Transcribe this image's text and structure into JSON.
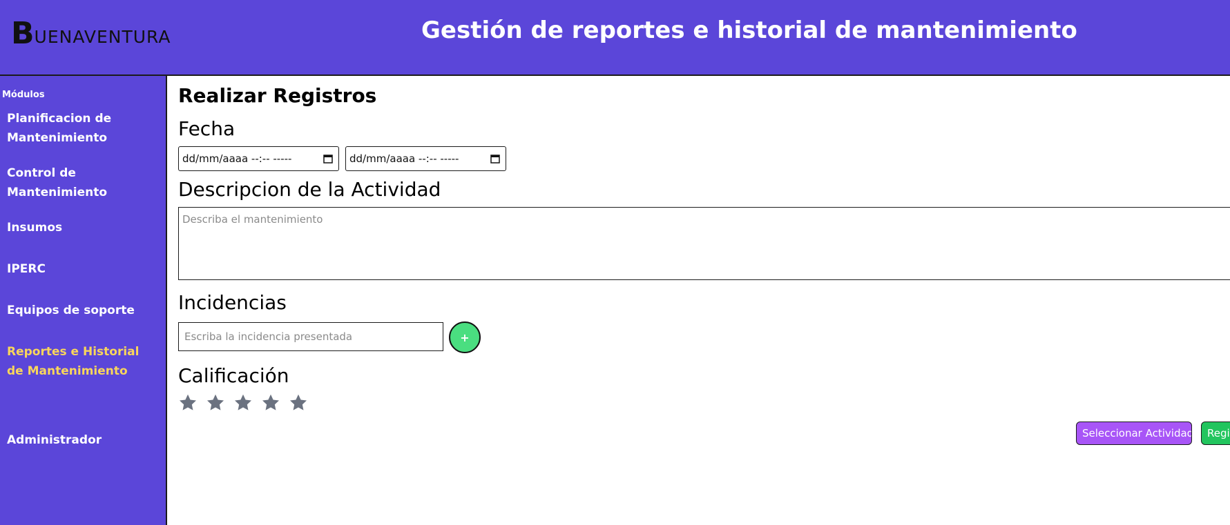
{
  "header": {
    "logo_initial": "B",
    "logo_rest": "UENAVENTURA",
    "title": "Gestión de reportes e historial de mantenimiento"
  },
  "sidebar": {
    "heading": "Módulos",
    "items": [
      {
        "label": "Planificacion de Mantenimiento",
        "active": false
      },
      {
        "label": "Control de Mantenimiento",
        "active": false
      },
      {
        "label": "Insumos",
        "active": false
      },
      {
        "label": "IPERC",
        "active": false
      },
      {
        "label": "Equipos de soporte",
        "active": false
      },
      {
        "label": "Reportes e Historial de Mantenimiento",
        "active": true
      },
      {
        "label": "Administrador",
        "active": false
      }
    ]
  },
  "form": {
    "title": "Realizar Registros",
    "date_label": "Fecha",
    "date_start_placeholder": "dd/mm/aaaa --:-- -----",
    "date_end_placeholder": "dd/mm/aaaa --:-- -----",
    "description_label": "Descripcion de la Actividad",
    "description_placeholder": "Describa el mantenimiento",
    "incidents_label": "Incidencias",
    "incident_placeholder": "Escriba la incidencia presentada",
    "add_incident_label": "+",
    "rating_label": "Calificación",
    "rating": {
      "value": 0,
      "max": 5
    }
  },
  "actions": {
    "select_activity_label": "Seleccionar Actividad",
    "register_label": "Regis"
  },
  "icons": {
    "calendar": "calendar-icon",
    "star": "star-icon"
  },
  "colors": {
    "brand_purple": "#5b46d9",
    "active_nav": "#f9d65b",
    "add_button": "#4ade80",
    "select_button": "#a855f7",
    "register_button": "#22c55e",
    "star_empty": "#6b7280"
  }
}
